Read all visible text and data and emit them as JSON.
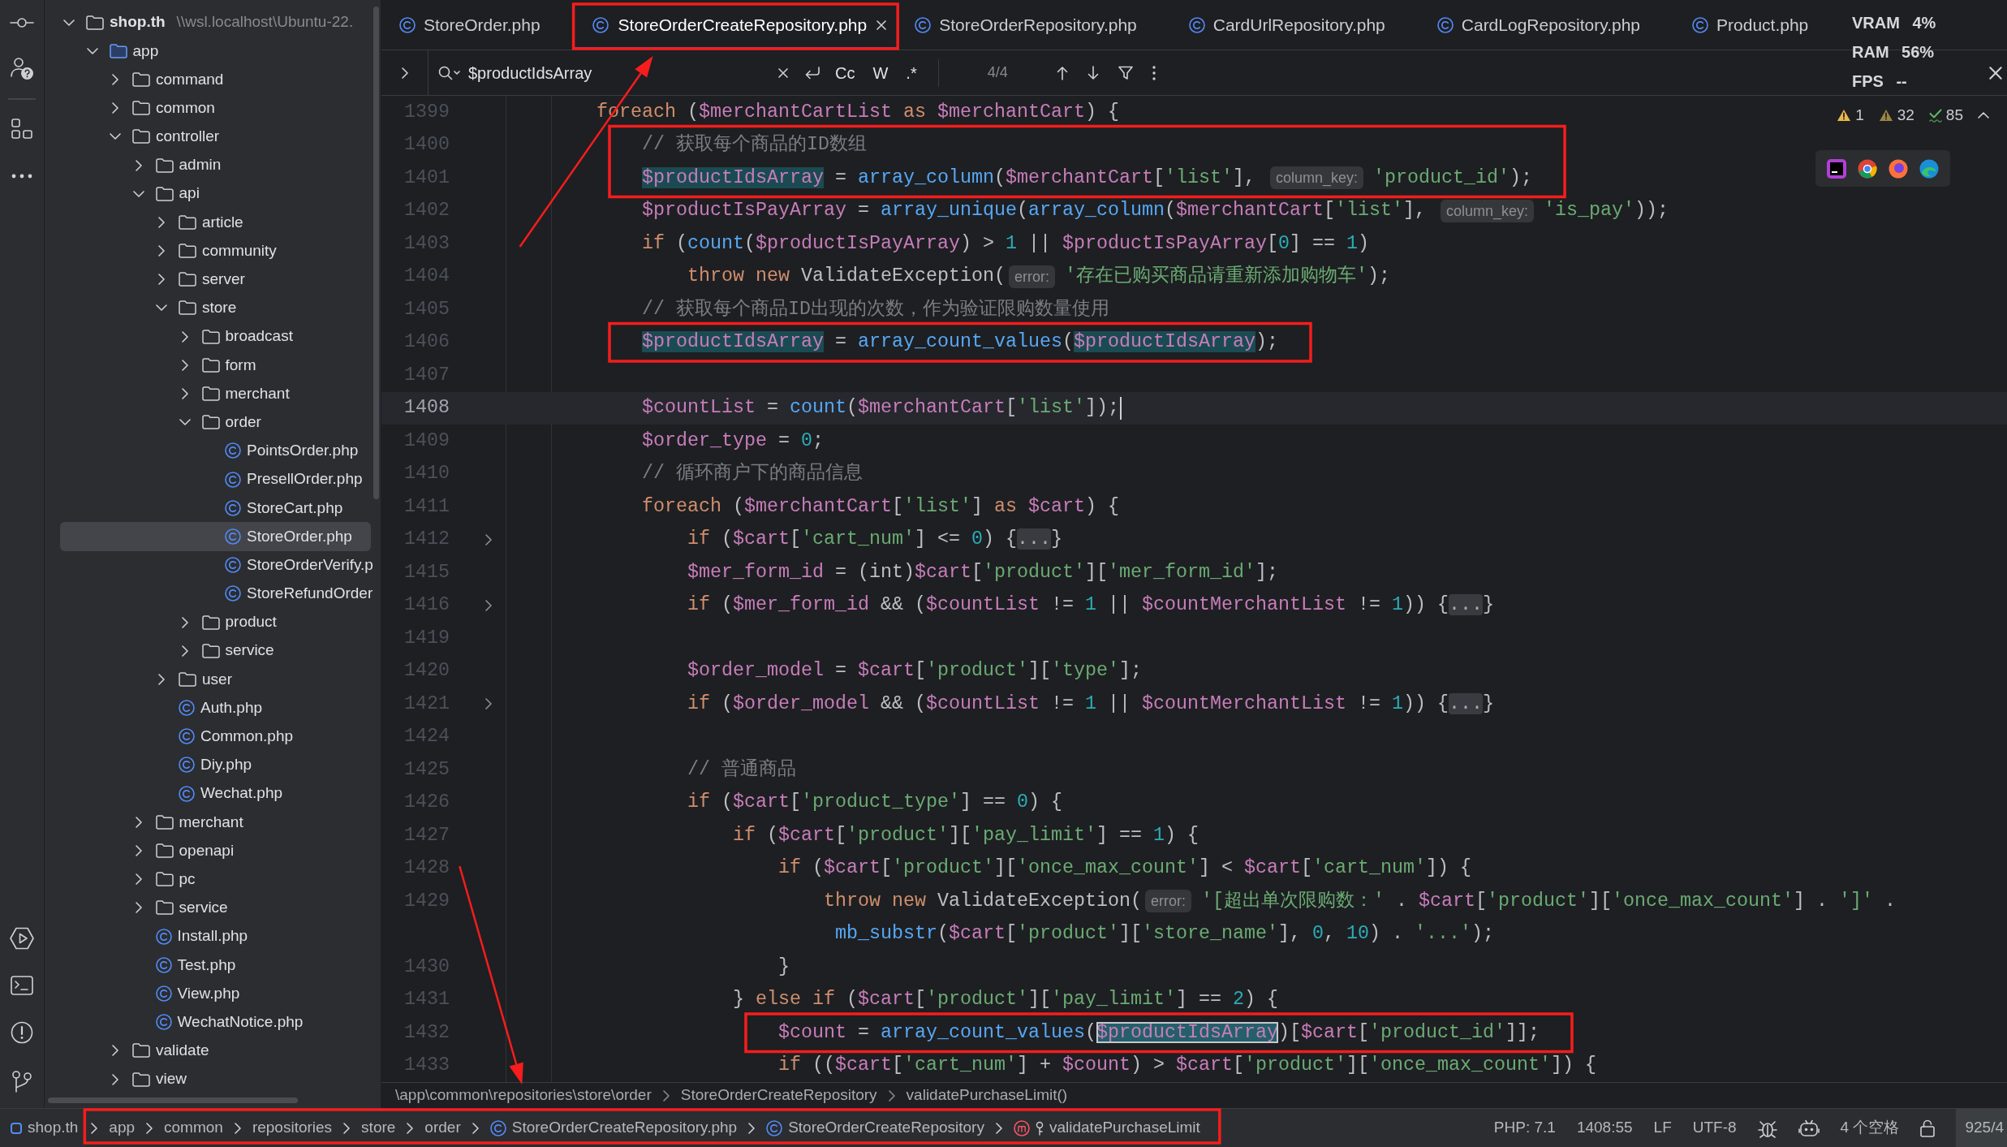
{
  "project_tree": [
    {
      "label": "shop.th",
      "path": "\\\\wsl.localhost\\Ubuntu-22.",
      "kind": "folder",
      "expanded": true,
      "selected": false,
      "children": [
        {
          "label": "app",
          "kind": "source-folder",
          "expanded": true,
          "selected": false,
          "children": [
            {
              "label": "command",
              "kind": "folder",
              "expanded": false,
              "selected": false
            },
            {
              "label": "common",
              "kind": "folder",
              "expanded": false,
              "selected": false
            },
            {
              "label": "controller",
              "kind": "folder",
              "expanded": true,
              "selected": false,
              "children": [
                {
                  "label": "admin",
                  "kind": "folder",
                  "expanded": false,
                  "selected": false
                },
                {
                  "label": "api",
                  "kind": "folder",
                  "expanded": true,
                  "selected": false,
                  "children": [
                    {
                      "label": "article",
                      "kind": "folder",
                      "expanded": false,
                      "selected": false
                    },
                    {
                      "label": "community",
                      "kind": "folder",
                      "expanded": false,
                      "selected": false
                    },
                    {
                      "label": "server",
                      "kind": "folder",
                      "expanded": false,
                      "selected": false
                    },
                    {
                      "label": "store",
                      "kind": "folder",
                      "expanded": true,
                      "selected": false,
                      "children": [
                        {
                          "label": "broadcast",
                          "kind": "folder",
                          "expanded": false,
                          "selected": false
                        },
                        {
                          "label": "form",
                          "kind": "folder",
                          "expanded": false,
                          "selected": false
                        },
                        {
                          "label": "merchant",
                          "kind": "folder",
                          "expanded": false,
                          "selected": false
                        },
                        {
                          "label": "order",
                          "kind": "folder",
                          "expanded": true,
                          "selected": false,
                          "children": [
                            {
                              "label": "PointsOrder.php",
                              "kind": "class",
                              "selected": false
                            },
                            {
                              "label": "PresellOrder.php",
                              "kind": "class",
                              "selected": false
                            },
                            {
                              "label": "StoreCart.php",
                              "kind": "class",
                              "selected": false
                            },
                            {
                              "label": "StoreOrder.php",
                              "kind": "class",
                              "selected": true
                            },
                            {
                              "label": "StoreOrderVerify.p",
                              "kind": "class",
                              "selected": false
                            },
                            {
                              "label": "StoreRefundOrder",
                              "kind": "class",
                              "selected": false
                            }
                          ]
                        },
                        {
                          "label": "product",
                          "kind": "folder",
                          "expanded": false,
                          "selected": false
                        },
                        {
                          "label": "service",
                          "kind": "folder",
                          "expanded": false,
                          "selected": false
                        }
                      ]
                    },
                    {
                      "label": "user",
                      "kind": "folder",
                      "expanded": false,
                      "selected": false
                    },
                    {
                      "label": "Auth.php",
                      "kind": "class",
                      "selected": false
                    },
                    {
                      "label": "Common.php",
                      "kind": "class",
                      "selected": false
                    },
                    {
                      "label": "Diy.php",
                      "kind": "class",
                      "selected": false
                    },
                    {
                      "label": "Wechat.php",
                      "kind": "class",
                      "selected": false
                    }
                  ]
                },
                {
                  "label": "merchant",
                  "kind": "folder",
                  "expanded": false,
                  "selected": false
                },
                {
                  "label": "openapi",
                  "kind": "folder",
                  "expanded": false,
                  "selected": false
                },
                {
                  "label": "pc",
                  "kind": "folder",
                  "expanded": false,
                  "selected": false
                },
                {
                  "label": "service",
                  "kind": "folder",
                  "expanded": false,
                  "selected": false
                },
                {
                  "label": "Install.php",
                  "kind": "class",
                  "selected": false
                },
                {
                  "label": "Test.php",
                  "kind": "class",
                  "selected": false
                },
                {
                  "label": "View.php",
                  "kind": "class",
                  "selected": false
                },
                {
                  "label": "WechatNotice.php",
                  "kind": "class",
                  "selected": false
                }
              ]
            },
            {
              "label": "validate",
              "kind": "folder",
              "expanded": false,
              "selected": false
            },
            {
              "label": "view",
              "kind": "folder",
              "expanded": false,
              "selected": false
            }
          ]
        }
      ]
    }
  ],
  "tabs": [
    {
      "label": "StoreOrder.php",
      "selected": false,
      "red_box": false,
      "arrow": false
    },
    {
      "label": "StoreOrderCreateRepository.php",
      "selected": true,
      "red_box": true,
      "arrow": true
    },
    {
      "label": "StoreOrderRepository.php",
      "selected": false,
      "red_box": false,
      "arrow": false
    },
    {
      "label": "CardUrlRepository.php",
      "selected": false,
      "red_box": false,
      "arrow": false
    },
    {
      "label": "CardLogRepository.php",
      "selected": false,
      "red_box": false,
      "arrow": false
    },
    {
      "label": "Product.php",
      "selected": false,
      "red_box": false,
      "arrow": false
    }
  ],
  "performance_overlay": [
    "VRAM 4%",
    "RAM 56%",
    "FPS --"
  ],
  "search": {
    "value": "$productIdsArray",
    "toggles": [
      "Cc",
      "W",
      ".*"
    ],
    "result": "4/4"
  },
  "inspections": [
    {
      "kind": "warning",
      "count": "1"
    },
    {
      "kind": "weak-warning",
      "count": "32"
    },
    {
      "kind": "ok",
      "count": "85"
    }
  ],
  "code": {
    "lines": [
      {
        "number": "1399",
        "current": false,
        "folded": false,
        "red_box": false,
        "tokens": [
          {
            "kind": "keyword",
            "text": "        foreach"
          },
          {
            "kind": "plain",
            "text": " ("
          },
          {
            "kind": "variable",
            "text": "$merchantCartList"
          },
          {
            "kind": "keyword",
            "text": " as "
          },
          {
            "kind": "variable",
            "text": "$merchantCart"
          },
          {
            "kind": "plain",
            "text": ") {"
          }
        ]
      },
      {
        "number": "1400",
        "current": false,
        "folded": false,
        "red_box": true,
        "tokens": [
          {
            "kind": "comment",
            "text": "            // 获取每个商品的ID数组"
          }
        ]
      },
      {
        "number": "1401",
        "current": false,
        "folded": false,
        "red_box": true,
        "tokens": [
          {
            "kind": "match",
            "text": "            $productIdsArray"
          },
          {
            "kind": "plain",
            "text": " = "
          },
          {
            "kind": "function",
            "text": "array_column"
          },
          {
            "kind": "plain",
            "text": "("
          },
          {
            "kind": "variable",
            "text": "$merchantCart"
          },
          {
            "kind": "plain",
            "text": "["
          },
          {
            "kind": "string",
            "text": "'list'"
          },
          {
            "kind": "plain",
            "text": "], "
          },
          {
            "kind": "hint",
            "text": "column_key:"
          },
          {
            "kind": "string",
            "text": "'product_id'"
          },
          {
            "kind": "plain",
            "text": ");"
          }
        ]
      },
      {
        "number": "1402",
        "current": false,
        "folded": false,
        "red_box": false,
        "tokens": [
          {
            "kind": "variable",
            "text": "            $productIsPayArray"
          },
          {
            "kind": "plain",
            "text": " = "
          },
          {
            "kind": "function",
            "text": "array_unique"
          },
          {
            "kind": "plain",
            "text": "("
          },
          {
            "kind": "function",
            "text": "array_column"
          },
          {
            "kind": "plain",
            "text": "("
          },
          {
            "kind": "variable",
            "text": "$merchantCart"
          },
          {
            "kind": "plain",
            "text": "["
          },
          {
            "kind": "string",
            "text": "'list'"
          },
          {
            "kind": "plain",
            "text": "], "
          },
          {
            "kind": "hint",
            "text": "column_key:"
          },
          {
            "kind": "string",
            "text": "'is_pay'"
          },
          {
            "kind": "plain",
            "text": "));"
          }
        ]
      },
      {
        "number": "1403",
        "current": false,
        "folded": false,
        "red_box": false,
        "tokens": [
          {
            "kind": "keyword",
            "text": "            if"
          },
          {
            "kind": "plain",
            "text": " ("
          },
          {
            "kind": "function",
            "text": "count"
          },
          {
            "kind": "plain",
            "text": "("
          },
          {
            "kind": "variable",
            "text": "$productIsPayArray"
          },
          {
            "kind": "plain",
            "text": ") > "
          },
          {
            "kind": "number",
            "text": "1"
          },
          {
            "kind": "plain",
            "text": " || "
          },
          {
            "kind": "variable",
            "text": "$productIsPayArray"
          },
          {
            "kind": "plain",
            "text": "["
          },
          {
            "kind": "number",
            "text": "0"
          },
          {
            "kind": "plain",
            "text": "] == "
          },
          {
            "kind": "number",
            "text": "1"
          },
          {
            "kind": "plain",
            "text": ")"
          }
        ]
      },
      {
        "number": "1404",
        "current": false,
        "folded": false,
        "red_box": false,
        "tokens": [
          {
            "kind": "keyword",
            "text": "                throw"
          },
          {
            "kind": "keyword",
            "text": " new"
          },
          {
            "kind": "plain",
            "text": " ValidateException("
          },
          {
            "kind": "hint",
            "text": "error:"
          },
          {
            "kind": "string",
            "text": "'存在已购买商品请重新添加购物车'"
          },
          {
            "kind": "plain",
            "text": ");"
          }
        ]
      },
      {
        "number": "1405",
        "current": false,
        "folded": false,
        "red_box": false,
        "tokens": [
          {
            "kind": "comment",
            "text": "            // 获取每个商品ID出现的次数，作为验证限购数量使用"
          }
        ]
      },
      {
        "number": "1406",
        "current": false,
        "folded": false,
        "red_box": true,
        "tokens": [
          {
            "kind": "match",
            "text": "            $productIdsArray"
          },
          {
            "kind": "plain",
            "text": " = "
          },
          {
            "kind": "function",
            "text": "array_count_values"
          },
          {
            "kind": "plain",
            "text": "("
          },
          {
            "kind": "match",
            "text": "$productIdsArray"
          },
          {
            "kind": "plain",
            "text": ");"
          }
        ]
      },
      {
        "number": "1407",
        "current": false,
        "folded": false,
        "red_box": false
      },
      {
        "number": "1408",
        "current": true,
        "folded": false,
        "red_box": false,
        "tokens": [
          {
            "kind": "variable",
            "text": "            $countList"
          },
          {
            "kind": "plain",
            "text": " = "
          },
          {
            "kind": "function",
            "text": "count"
          },
          {
            "kind": "plain",
            "text": "("
          },
          {
            "kind": "variable",
            "text": "$merchantCart"
          },
          {
            "kind": "plain",
            "text": "["
          },
          {
            "kind": "string",
            "text": "'list'"
          },
          {
            "kind": "plain",
            "text": "]);"
          }
        ]
      },
      {
        "number": "1409",
        "current": false,
        "folded": false,
        "red_box": false,
        "tokens": [
          {
            "kind": "variable",
            "text": "            $order_type"
          },
          {
            "kind": "plain",
            "text": " = "
          },
          {
            "kind": "number",
            "text": "0"
          },
          {
            "kind": "plain",
            "text": ";"
          }
        ]
      },
      {
        "number": "1410",
        "current": false,
        "folded": false,
        "red_box": false,
        "tokens": [
          {
            "kind": "comment",
            "text": "            // 循环商户下的商品信息"
          }
        ]
      },
      {
        "number": "1411",
        "current": false,
        "folded": false,
        "red_box": false,
        "tokens": [
          {
            "kind": "keyword",
            "text": "            foreach"
          },
          {
            "kind": "plain",
            "text": " ("
          },
          {
            "kind": "variable",
            "text": "$merchantCart"
          },
          {
            "kind": "plain",
            "text": "["
          },
          {
            "kind": "string",
            "text": "'list'"
          },
          {
            "kind": "plain",
            "text": "] "
          },
          {
            "kind": "keyword",
            "text": "as "
          },
          {
            "kind": "variable",
            "text": "$cart"
          },
          {
            "kind": "plain",
            "text": ") {"
          }
        ]
      },
      {
        "number": "1412",
        "current": false,
        "folded": true,
        "red_box": false,
        "tokens": [
          {
            "kind": "keyword",
            "text": "                if"
          },
          {
            "kind": "plain",
            "text": " ("
          },
          {
            "kind": "variable",
            "text": "$cart"
          },
          {
            "kind": "plain",
            "text": "["
          },
          {
            "kind": "string",
            "text": "'cart_num'"
          },
          {
            "kind": "plain",
            "text": "] <= "
          },
          {
            "kind": "number",
            "text": "0"
          },
          {
            "kind": "plain",
            "text": ") {"
          },
          {
            "kind": "fold",
            "text": "..."
          },
          {
            "kind": "plain",
            "text": "}"
          }
        ]
      },
      {
        "number": "1415",
        "current": false,
        "folded": false,
        "red_box": false,
        "tokens": [
          {
            "kind": "variable",
            "text": "                $mer_form_id"
          },
          {
            "kind": "plain",
            "text": " = (int)"
          },
          {
            "kind": "variable",
            "text": "$cart"
          },
          {
            "kind": "plain",
            "text": "["
          },
          {
            "kind": "string",
            "text": "'product'"
          },
          {
            "kind": "plain",
            "text": "]["
          },
          {
            "kind": "string",
            "text": "'mer_form_id'"
          },
          {
            "kind": "plain",
            "text": "];"
          }
        ]
      },
      {
        "number": "1416",
        "current": false,
        "folded": true,
        "red_box": false,
        "tokens": [
          {
            "kind": "keyword",
            "text": "                if"
          },
          {
            "kind": "plain",
            "text": " ("
          },
          {
            "kind": "variable",
            "text": "$mer_form_id"
          },
          {
            "kind": "plain",
            "text": " && ("
          },
          {
            "kind": "variable",
            "text": "$countList"
          },
          {
            "kind": "plain",
            "text": " != "
          },
          {
            "kind": "number",
            "text": "1"
          },
          {
            "kind": "plain",
            "text": " || "
          },
          {
            "kind": "variable",
            "text": "$countMerchantList"
          },
          {
            "kind": "plain",
            "text": " != "
          },
          {
            "kind": "number",
            "text": "1"
          },
          {
            "kind": "plain",
            "text": ")) {"
          },
          {
            "kind": "fold",
            "text": "..."
          },
          {
            "kind": "plain",
            "text": "}"
          }
        ]
      },
      {
        "number": "1419",
        "current": false,
        "folded": false,
        "red_box": false
      },
      {
        "number": "1420",
        "current": false,
        "folded": false,
        "red_box": false,
        "tokens": [
          {
            "kind": "variable",
            "text": "                $order_model"
          },
          {
            "kind": "plain",
            "text": " = "
          },
          {
            "kind": "variable",
            "text": "$cart"
          },
          {
            "kind": "plain",
            "text": "["
          },
          {
            "kind": "string",
            "text": "'product'"
          },
          {
            "kind": "plain",
            "text": "]["
          },
          {
            "kind": "string",
            "text": "'type'"
          },
          {
            "kind": "plain",
            "text": "];"
          }
        ]
      },
      {
        "number": "1421",
        "current": false,
        "folded": true,
        "red_box": false,
        "tokens": [
          {
            "kind": "keyword",
            "text": "                if"
          },
          {
            "kind": "plain",
            "text": " ("
          },
          {
            "kind": "variable",
            "text": "$order_model"
          },
          {
            "kind": "plain",
            "text": " && ("
          },
          {
            "kind": "variable",
            "text": "$countList"
          },
          {
            "kind": "plain",
            "text": " != "
          },
          {
            "kind": "number",
            "text": "1"
          },
          {
            "kind": "plain",
            "text": " || "
          },
          {
            "kind": "variable",
            "text": "$countMerchantList"
          },
          {
            "kind": "plain",
            "text": " != "
          },
          {
            "kind": "number",
            "text": "1"
          },
          {
            "kind": "plain",
            "text": ")) {"
          },
          {
            "kind": "fold",
            "text": "..."
          },
          {
            "kind": "plain",
            "text": "}"
          }
        ]
      },
      {
        "number": "1424",
        "current": false,
        "folded": false,
        "red_box": false
      },
      {
        "number": "1425",
        "current": false,
        "folded": false,
        "red_box": false,
        "tokens": [
          {
            "kind": "comment",
            "text": "                // 普通商品"
          }
        ]
      },
      {
        "number": "1426",
        "current": false,
        "folded": false,
        "red_box": false,
        "tokens": [
          {
            "kind": "keyword",
            "text": "                if"
          },
          {
            "kind": "plain",
            "text": " ("
          },
          {
            "kind": "variable",
            "text": "$cart"
          },
          {
            "kind": "plain",
            "text": "["
          },
          {
            "kind": "string",
            "text": "'product_type'"
          },
          {
            "kind": "plain",
            "text": "] == "
          },
          {
            "kind": "number",
            "text": "0"
          },
          {
            "kind": "plain",
            "text": ") {"
          }
        ]
      },
      {
        "number": "1427",
        "current": false,
        "folded": false,
        "red_box": false,
        "tokens": [
          {
            "kind": "keyword",
            "text": "                    if"
          },
          {
            "kind": "plain",
            "text": " ("
          },
          {
            "kind": "variable",
            "text": "$cart"
          },
          {
            "kind": "plain",
            "text": "["
          },
          {
            "kind": "string",
            "text": "'product'"
          },
          {
            "kind": "plain",
            "text": "]["
          },
          {
            "kind": "string",
            "text": "'pay_limit'"
          },
          {
            "kind": "plain",
            "text": "] == "
          },
          {
            "kind": "number",
            "text": "1"
          },
          {
            "kind": "plain",
            "text": ") {"
          }
        ]
      },
      {
        "number": "1428",
        "current": false,
        "folded": false,
        "red_box": false,
        "tokens": [
          {
            "kind": "keyword",
            "text": "                        if"
          },
          {
            "kind": "plain",
            "text": " ("
          },
          {
            "kind": "variable",
            "text": "$cart"
          },
          {
            "kind": "plain",
            "text": "["
          },
          {
            "kind": "string",
            "text": "'product'"
          },
          {
            "kind": "plain",
            "text": "]["
          },
          {
            "kind": "string",
            "text": "'once_max_count'"
          },
          {
            "kind": "plain",
            "text": "] < "
          },
          {
            "kind": "variable",
            "text": "$cart"
          },
          {
            "kind": "plain",
            "text": "["
          },
          {
            "kind": "string",
            "text": "'cart_num'"
          },
          {
            "kind": "plain",
            "text": "]) {"
          }
        ]
      },
      {
        "number": "1429",
        "current": false,
        "folded": false,
        "red_box": false,
        "tokens": [
          {
            "kind": "keyword",
            "text": "                            throw"
          },
          {
            "kind": "keyword",
            "text": " new"
          },
          {
            "kind": "plain",
            "text": " ValidateException("
          },
          {
            "kind": "hint",
            "text": "error:"
          },
          {
            "kind": "string",
            "text": "'[超出单次限购数：'"
          },
          {
            "kind": "plain",
            "text": " . "
          },
          {
            "kind": "variable",
            "text": "$cart"
          },
          {
            "kind": "plain",
            "text": "["
          },
          {
            "kind": "string",
            "text": "'product'"
          },
          {
            "kind": "plain",
            "text": "]["
          },
          {
            "kind": "string",
            "text": "'once_max_count'"
          },
          {
            "kind": "plain",
            "text": "] . "
          },
          {
            "kind": "string",
            "text": "']'"
          },
          {
            "kind": "plain",
            "text": " ."
          }
        ]
      },
      {
        "current": false,
        "folded": false,
        "red_box": false,
        "tokens": [
          {
            "kind": "function",
            "text": "                             mb_substr"
          },
          {
            "kind": "plain",
            "text": "("
          },
          {
            "kind": "variable",
            "text": "$cart"
          },
          {
            "kind": "plain",
            "text": "["
          },
          {
            "kind": "string",
            "text": "'product'"
          },
          {
            "kind": "plain",
            "text": "]["
          },
          {
            "kind": "string",
            "text": "'store_name'"
          },
          {
            "kind": "plain",
            "text": "], "
          },
          {
            "kind": "number",
            "text": "0"
          },
          {
            "kind": "plain",
            "text": ", "
          },
          {
            "kind": "number",
            "text": "10"
          },
          {
            "kind": "plain",
            "text": ") . "
          },
          {
            "kind": "string",
            "text": "'...'"
          },
          {
            "kind": "plain",
            "text": ");"
          }
        ]
      },
      {
        "number": "1430",
        "current": false,
        "folded": false,
        "red_box": false,
        "tokens": [
          {
            "kind": "plain",
            "text": "                        }"
          }
        ]
      },
      {
        "number": "1431",
        "current": false,
        "folded": false,
        "red_box": false,
        "tokens": [
          {
            "kind": "plain",
            "text": "                    } "
          },
          {
            "kind": "keyword",
            "text": "else"
          },
          {
            "kind": "keyword",
            "text": " if"
          },
          {
            "kind": "plain",
            "text": " ("
          },
          {
            "kind": "variable",
            "text": "$cart"
          },
          {
            "kind": "plain",
            "text": "["
          },
          {
            "kind": "string",
            "text": "'product'"
          },
          {
            "kind": "plain",
            "text": "]["
          },
          {
            "kind": "string",
            "text": "'pay_limit'"
          },
          {
            "kind": "plain",
            "text": "] == "
          },
          {
            "kind": "number",
            "text": "2"
          },
          {
            "kind": "plain",
            "text": ") {"
          }
        ]
      },
      {
        "number": "1432",
        "current": false,
        "folded": false,
        "red_box": true,
        "tokens": [
          {
            "kind": "variable",
            "text": "                        $count"
          },
          {
            "kind": "plain",
            "text": " = "
          },
          {
            "kind": "function",
            "text": "array_count_values"
          },
          {
            "kind": "plain",
            "text": "("
          },
          {
            "kind": "match-current",
            "text": "$productIdsArray"
          },
          {
            "kind": "plain",
            "text": ")["
          },
          {
            "kind": "variable",
            "text": "$cart"
          },
          {
            "kind": "plain",
            "text": "["
          },
          {
            "kind": "string",
            "text": "'product_id'"
          },
          {
            "kind": "plain",
            "text": "]];"
          }
        ]
      },
      {
        "number": "1433",
        "current": false,
        "folded": false,
        "red_box": false,
        "tokens": [
          {
            "kind": "keyword",
            "text": "                        if"
          },
          {
            "kind": "plain",
            "text": " (("
          },
          {
            "kind": "variable",
            "text": "$cart"
          },
          {
            "kind": "plain",
            "text": "["
          },
          {
            "kind": "string",
            "text": "'cart_num'"
          },
          {
            "kind": "plain",
            "text": "] + "
          },
          {
            "kind": "variable",
            "text": "$count"
          },
          {
            "kind": "plain",
            "text": ") > "
          },
          {
            "kind": "variable",
            "text": "$cart"
          },
          {
            "kind": "plain",
            "text": "["
          },
          {
            "kind": "string",
            "text": "'product'"
          },
          {
            "kind": "plain",
            "text": "]["
          },
          {
            "kind": "string",
            "text": "'once_max_count'"
          },
          {
            "kind": "plain",
            "text": "]) {"
          }
        ]
      }
    ]
  },
  "editor_breadcrumb": [
    "\\app\\common\\repositories\\store\\order",
    "StoreOrderCreateRepository",
    "validatePurchaseLimit()"
  ],
  "status_bar": {
    "project": "shop.th",
    "path": [
      {
        "kind": "folder",
        "text": "app"
      },
      {
        "kind": "folder",
        "text": "common"
      },
      {
        "kind": "folder",
        "text": "repositories"
      },
      {
        "kind": "folder",
        "text": "store"
      },
      {
        "kind": "folder",
        "text": "order"
      },
      {
        "kind": "class",
        "text": "StoreOrderCreateRepository.php"
      },
      {
        "kind": "class",
        "text": "StoreOrderCreateRepository"
      },
      {
        "kind": "method",
        "text": "validatePurchaseLimit"
      }
    ],
    "red_box": true,
    "arrow": true,
    "indicators": [
      "PHP: 7.1",
      "1408:55",
      "LF",
      "UTF-8",
      "4 个空格"
    ],
    "memory": "925/4"
  }
}
